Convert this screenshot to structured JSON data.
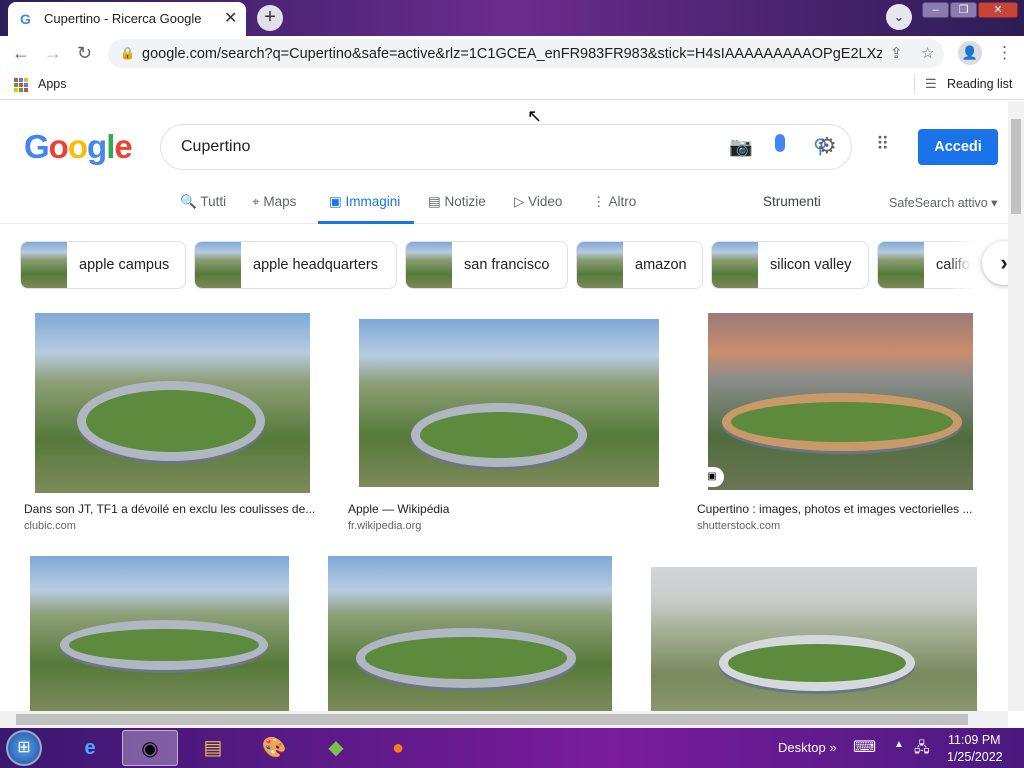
{
  "browser": {
    "tab_title": "Cupertino - Ricerca Google",
    "url": "google.com/search?q=Cupertino&safe=active&rlz=1C1GCEA_enFR983FR983&stick=H4sIAAAAAAAAAOPgE2LXz9U3y...",
    "bookmarks": {
      "apps": "Apps",
      "reading_list": "Reading list"
    }
  },
  "google": {
    "logo": "Google",
    "query": "Cupertino",
    "login": "Accedi",
    "tabs": [
      {
        "label": "Tutti",
        "icon": "🔍"
      },
      {
        "label": "Maps",
        "icon": "⌖"
      },
      {
        "label": "Immagini",
        "icon": "▣"
      },
      {
        "label": "Notizie",
        "icon": "▤"
      },
      {
        "label": "Video",
        "icon": "▷"
      },
      {
        "label": "Altro",
        "icon": "⋮"
      }
    ],
    "tools": "Strumenti",
    "safesearch": "SafeSearch attivo"
  },
  "chips": [
    "apple campus",
    "apple headquarters",
    "san francisco",
    "amazon",
    "silicon valley",
    "califo"
  ],
  "results": [
    {
      "caption": "Dans son JT, TF1 a dévoilé en exclu les coulisses de...",
      "source": "clubic.com"
    },
    {
      "caption": "Apple — Wikipédia",
      "source": "fr.wikipedia.org"
    },
    {
      "caption": "Cupertino : images, photos et images vectorielles ...",
      "source": "shutterstock.com"
    },
    {
      "caption": "",
      "source": ""
    },
    {
      "caption": "",
      "source": ""
    },
    {
      "caption": "",
      "source": ""
    }
  ],
  "taskbar": {
    "desktop": "Desktop",
    "time": "11:09 PM",
    "date": "1/25/2022"
  }
}
